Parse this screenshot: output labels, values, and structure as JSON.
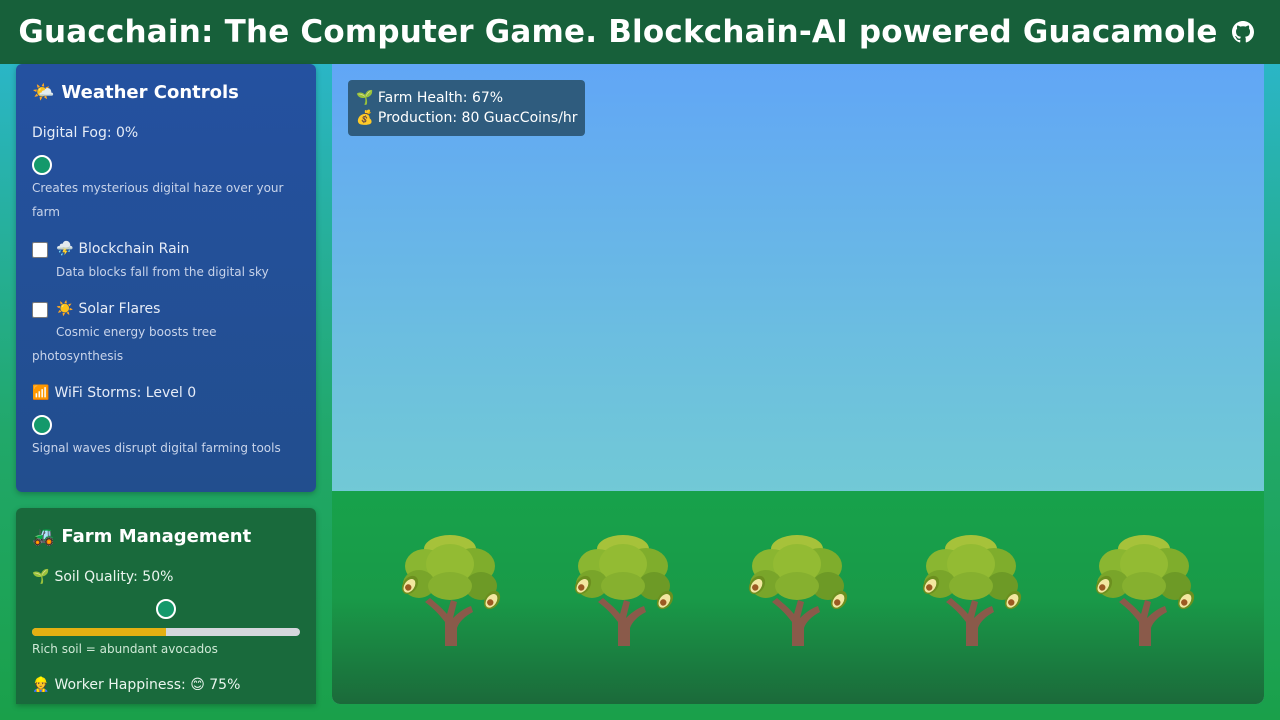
{
  "header": {
    "title": "Guacchain: The Computer Game. Blockchain-AI powered Guacamole",
    "github_icon": "github-icon"
  },
  "weather": {
    "title_icon": "🌤️",
    "title": "Weather Controls",
    "digital_fog": {
      "label": "Digital Fog: 0%",
      "value": 0,
      "desc": "Creates mysterious digital haze over your farm"
    },
    "blockchain_rain": {
      "icon": "⛈️",
      "label": "Blockchain Rain",
      "checked": false,
      "desc": "Data blocks fall from the digital sky"
    },
    "solar_flares": {
      "icon": "☀️",
      "label": "Solar Flares",
      "checked": false,
      "desc_line1": "Cosmic energy boosts tree",
      "desc_line2": "photosynthesis"
    },
    "wifi_storms": {
      "icon": "📶",
      "label": "WiFi Storms: Level 0",
      "value": 0,
      "desc": "Signal waves disrupt digital farming tools"
    }
  },
  "farm": {
    "title_icon": "🚜",
    "title": "Farm Management",
    "soil": {
      "icon": "🌱",
      "label": "Soil Quality: 50%",
      "value": 0.5,
      "desc": "Rich soil = abundant avocados"
    },
    "worker": {
      "icon": "👷",
      "label": "Worker Happiness: 😊 75%"
    }
  },
  "scene": {
    "health": {
      "icon": "🌱",
      "text": "Farm Health: 67%"
    },
    "production": {
      "icon": "💰",
      "text": "Production: 80 GuacCoins/hr"
    },
    "tree_count": 5,
    "colors": {
      "sky_top": "#61a6f6",
      "sky_bottom": "#7ad8c8",
      "ground": "#17a24b",
      "stats_bg": "#2f5c7e"
    }
  },
  "colors": {
    "header": "#17603a",
    "weather_panel": "#2451a0",
    "farm_panel": "#196a3c",
    "accent": "#14996b",
    "soil_bar": "#e4b012"
  }
}
